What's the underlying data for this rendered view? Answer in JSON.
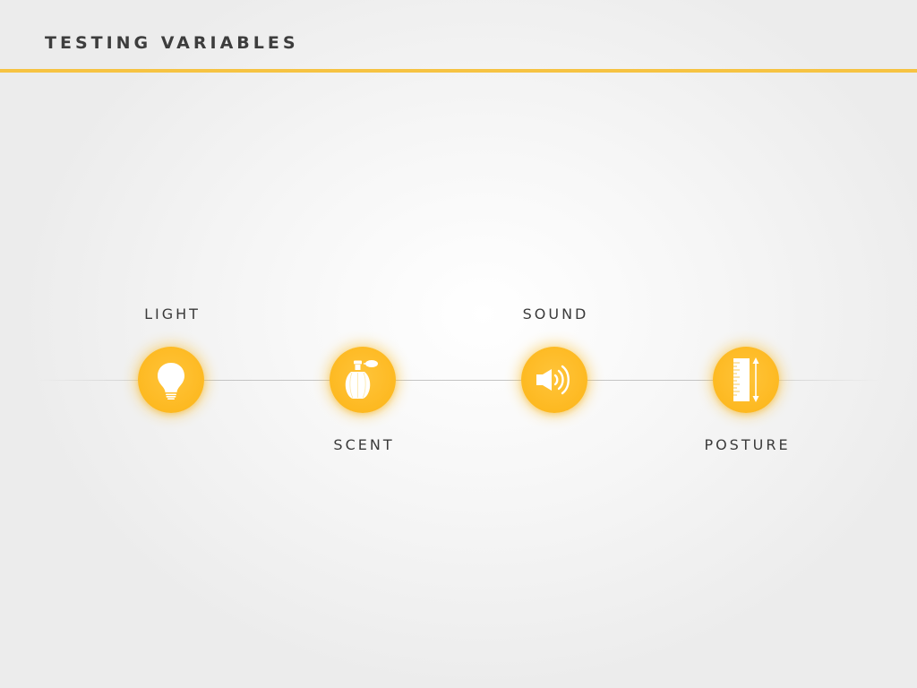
{
  "page": {
    "title": "TESTING VARIABLES"
  },
  "colors": {
    "accent": "#f6c342",
    "icon_fill": "#fdb921",
    "icon_glyph": "#ffffff",
    "text": "#3a3a3a"
  },
  "variables": [
    {
      "label": "LIGHT",
      "icon": "lightbulb-icon",
      "label_position": "above"
    },
    {
      "label": "SCENT",
      "icon": "perfume-bottle-icon",
      "label_position": "below"
    },
    {
      "label": "SOUND",
      "icon": "speaker-icon",
      "label_position": "above"
    },
    {
      "label": "POSTURE",
      "icon": "ruler-height-icon",
      "label_position": "below"
    }
  ]
}
